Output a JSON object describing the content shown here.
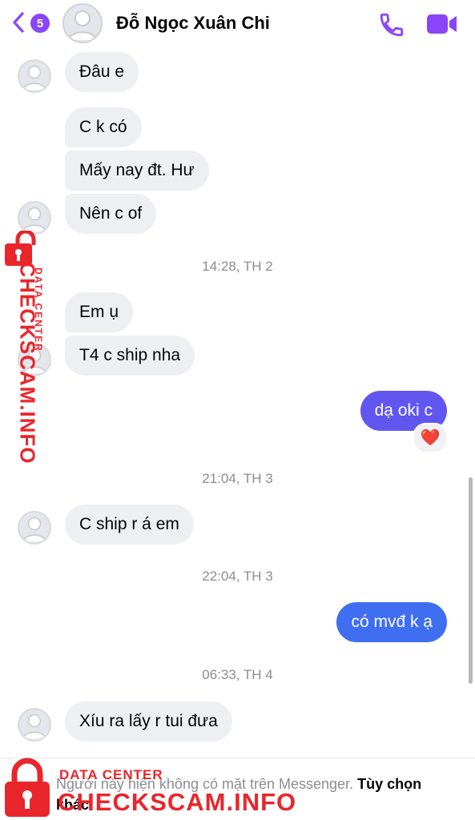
{
  "header": {
    "unread_count": "5",
    "contact_name": "Đỗ Ngọc Xuân Chi"
  },
  "messages": [
    {
      "text": "Đâu e"
    },
    {
      "text": "C k có"
    },
    {
      "text": "Mấy nay đt.  Hư"
    },
    {
      "text": "Nên c of"
    },
    {
      "text": "Em ụ"
    },
    {
      "text": "T4 c ship nha"
    },
    {
      "text": "dạ oki c"
    },
    {
      "text": "C ship r á em"
    },
    {
      "text": "có mvđ k ạ"
    },
    {
      "text": "Xíu ra lấy r tui đưa"
    }
  ],
  "timestamps": [
    "14:28, TH 2",
    "21:04, TH 3",
    "22:04, TH 3",
    "06:33, TH 4"
  ],
  "reaction": {
    "emoji": "❤️"
  },
  "footer": {
    "notice": "Người này hiện không có mặt trên Messenger.",
    "options_label": "Tùy chọn khác"
  },
  "watermark": {
    "small": "DATA CENTER",
    "big": "CHECKSCAM.INFO"
  },
  "colors": {
    "accent": "#8b44f7",
    "outgoing_purple": "#6157f0",
    "outgoing_blue": "#3f6ef0",
    "incoming_bg": "#eeeff2",
    "watermark_red": "#e8262b"
  },
  "icons": [
    "back-chevron-icon",
    "phone-icon",
    "video-camera-icon",
    "heart-icon",
    "lock-icon"
  ]
}
